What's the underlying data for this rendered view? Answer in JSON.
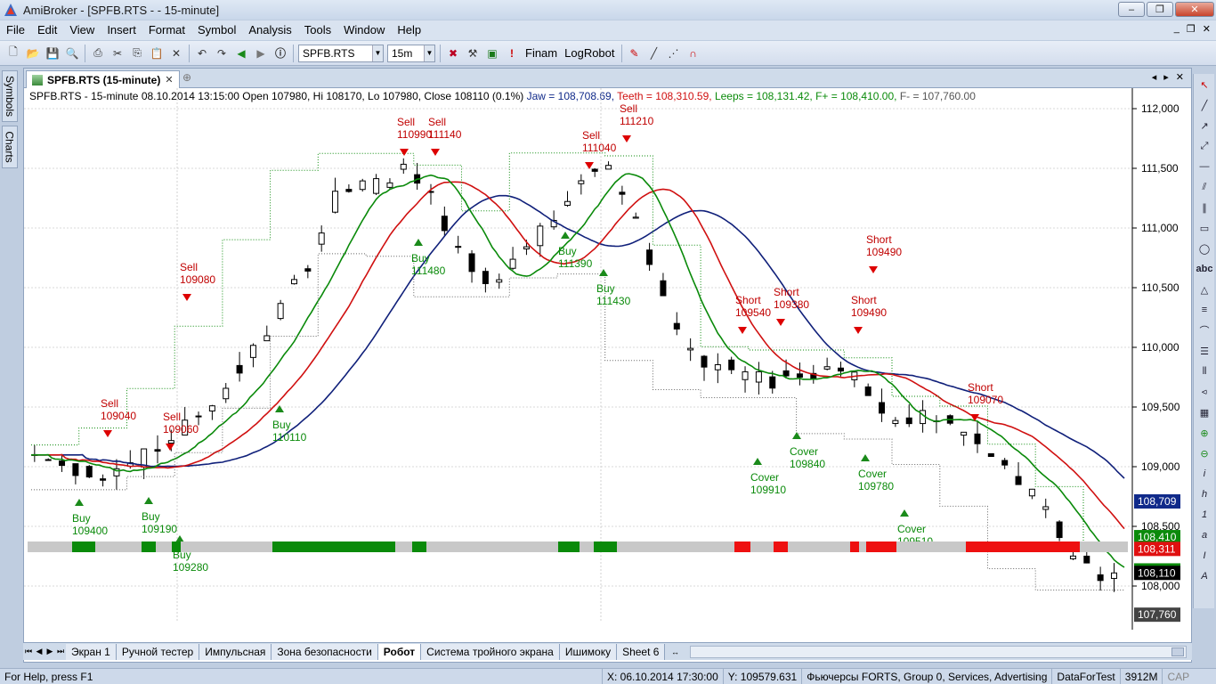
{
  "window": {
    "title": "AmiBroker - [SPFB.RTS -  - 15-minute]",
    "buttons": [
      "minimize",
      "restore",
      "close"
    ]
  },
  "menu": [
    "File",
    "Edit",
    "View",
    "Insert",
    "Format",
    "Symbol",
    "Analysis",
    "Tools",
    "Window",
    "Help"
  ],
  "toolbar": {
    "symbol": "SPFB.RTS",
    "interval": "15m",
    "labels": [
      "Finam",
      "LogRobot"
    ]
  },
  "left_tabs": [
    "Symbols",
    "Charts"
  ],
  "doc_tab": "SPFB.RTS (15-minute)",
  "info": {
    "main": "SPFB.RTS - 15-minute 08.10.2014 13:15:00 Open 107980, Hi 108170, Lo 107980, Close 108110 (0.1%)",
    "jaw": "Jaw = 108,708.69,",
    "teeth": "Teeth = 108,310.59,",
    "lips": "Leeps = 108,131.42,",
    "fplus": "F+ = 108,410.00,",
    "fminus": "F- = 107,760.00"
  },
  "chart_data": {
    "type": "candlestick",
    "y_ticks": [
      "112,000",
      "111,500",
      "111,000",
      "110,500",
      "110,000",
      "109,500",
      "109,000",
      "108,500",
      "108,000"
    ],
    "price_tags": [
      {
        "label": "108,709",
        "color": "#102a8a",
        "value": 108709
      },
      {
        "label": "108,410",
        "color": "#0a8a0a",
        "value": 108410
      },
      {
        "label": "108,311",
        "color": "#e01010",
        "value": 108311
      },
      {
        "label": "108,131",
        "color": "#0a8a0a",
        "value": 108131
      },
      {
        "label": "108,110",
        "color": "#000000",
        "value": 108110
      },
      {
        "label": "107,760",
        "color": "#444444",
        "value": 107760
      }
    ],
    "annotations": [
      {
        "text": "Sell",
        "value": "109040",
        "color": "#c00000",
        "x": 112,
        "y": 456
      },
      {
        "text": "Sell",
        "value": "109060",
        "color": "#c00000",
        "x": 182,
        "y": 471
      },
      {
        "text": "Sell",
        "value": "109080",
        "color": "#c00000",
        "x": 201,
        "y": 303
      },
      {
        "text": "Sell",
        "value": "110990",
        "color": "#c00000",
        "x": 445,
        "y": 140
      },
      {
        "text": "Sell",
        "value": "111140",
        "color": "#c00000",
        "x": 480,
        "y": 140
      },
      {
        "text": "Sell",
        "value": "111040",
        "color": "#c00000",
        "x": 653,
        "y": 155
      },
      {
        "text": "Sell",
        "value": "111210",
        "color": "#c00000",
        "x": 695,
        "y": 125
      },
      {
        "text": "Buy",
        "value": "109400",
        "color": "#0a8a0a",
        "x": 80,
        "y": 585
      },
      {
        "text": "Buy",
        "value": "109190",
        "color": "#0a8a0a",
        "x": 158,
        "y": 583
      },
      {
        "text": "Buy",
        "value": "109280",
        "color": "#0a8a0a",
        "x": 193,
        "y": 626
      },
      {
        "text": "Buy",
        "value": "110110",
        "color": "#0a8a0a",
        "x": 305,
        "y": 480
      },
      {
        "text": "Buy",
        "value": "111480",
        "color": "#0a8a0a",
        "x": 461,
        "y": 293
      },
      {
        "text": "Buy",
        "value": "111390",
        "color": "#0a8a0a",
        "x": 626,
        "y": 285
      },
      {
        "text": "Buy",
        "value": "111430",
        "color": "#0a8a0a",
        "x": 669,
        "y": 327
      },
      {
        "text": "Short",
        "value": "109540",
        "color": "#c00000",
        "x": 825,
        "y": 340
      },
      {
        "text": "Short",
        "value": "109380",
        "color": "#c00000",
        "x": 868,
        "y": 331
      },
      {
        "text": "Short",
        "value": "109490",
        "color": "#c00000",
        "x": 955,
        "y": 340
      },
      {
        "text": "Short",
        "value": "109490",
        "color": "#c00000",
        "x": 972,
        "y": 272
      },
      {
        "text": "Short",
        "value": "109070",
        "color": "#c00000",
        "x": 1086,
        "y": 438
      },
      {
        "text": "Cover",
        "value": "109910",
        "color": "#0a8a0a",
        "x": 842,
        "y": 539
      },
      {
        "text": "Cover",
        "value": "109840",
        "color": "#0a8a0a",
        "x": 886,
        "y": 510
      },
      {
        "text": "Cover",
        "value": "109780",
        "color": "#0a8a0a",
        "x": 963,
        "y": 535
      },
      {
        "text": "Cover",
        "value": "109510",
        "color": "#0a8a0a",
        "x": 1007,
        "y": 597
      }
    ]
  },
  "sheets": [
    "Экран 1",
    "Ручной тестер",
    "Импульсная",
    "Зона безопасности",
    "Робот",
    "Система тройного экрана",
    "Ишимоку",
    "Sheet 6"
  ],
  "active_sheet": "Робот",
  "status": {
    "help": "For Help, press F1",
    "x": "X: 06.10.2014 17:30:00",
    "y": "Y: 109579.631",
    "market": "Фьючерсы FORTS, Group 0, Services, Advertising",
    "source": "DataForTest",
    "memory": "3912M",
    "cap": "CAP"
  }
}
